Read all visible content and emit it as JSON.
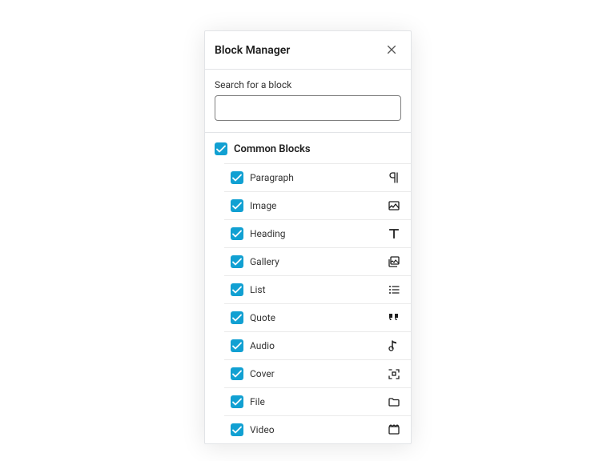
{
  "modal": {
    "title": "Block Manager",
    "search": {
      "label": "Search for a block",
      "value": ""
    }
  },
  "category": {
    "title": "Common Blocks",
    "checked": true
  },
  "blocks": [
    {
      "label": "Paragraph",
      "icon": "pilcrow",
      "checked": true
    },
    {
      "label": "Image",
      "icon": "image",
      "checked": true
    },
    {
      "label": "Heading",
      "icon": "heading",
      "checked": true
    },
    {
      "label": "Gallery",
      "icon": "gallery",
      "checked": true
    },
    {
      "label": "List",
      "icon": "list",
      "checked": true
    },
    {
      "label": "Quote",
      "icon": "quote",
      "checked": true
    },
    {
      "label": "Audio",
      "icon": "audio",
      "checked": true
    },
    {
      "label": "Cover",
      "icon": "cover",
      "checked": true
    },
    {
      "label": "File",
      "icon": "file",
      "checked": true
    },
    {
      "label": "Video",
      "icon": "video",
      "checked": true
    }
  ],
  "colors": {
    "accent": "#11a0d2"
  }
}
